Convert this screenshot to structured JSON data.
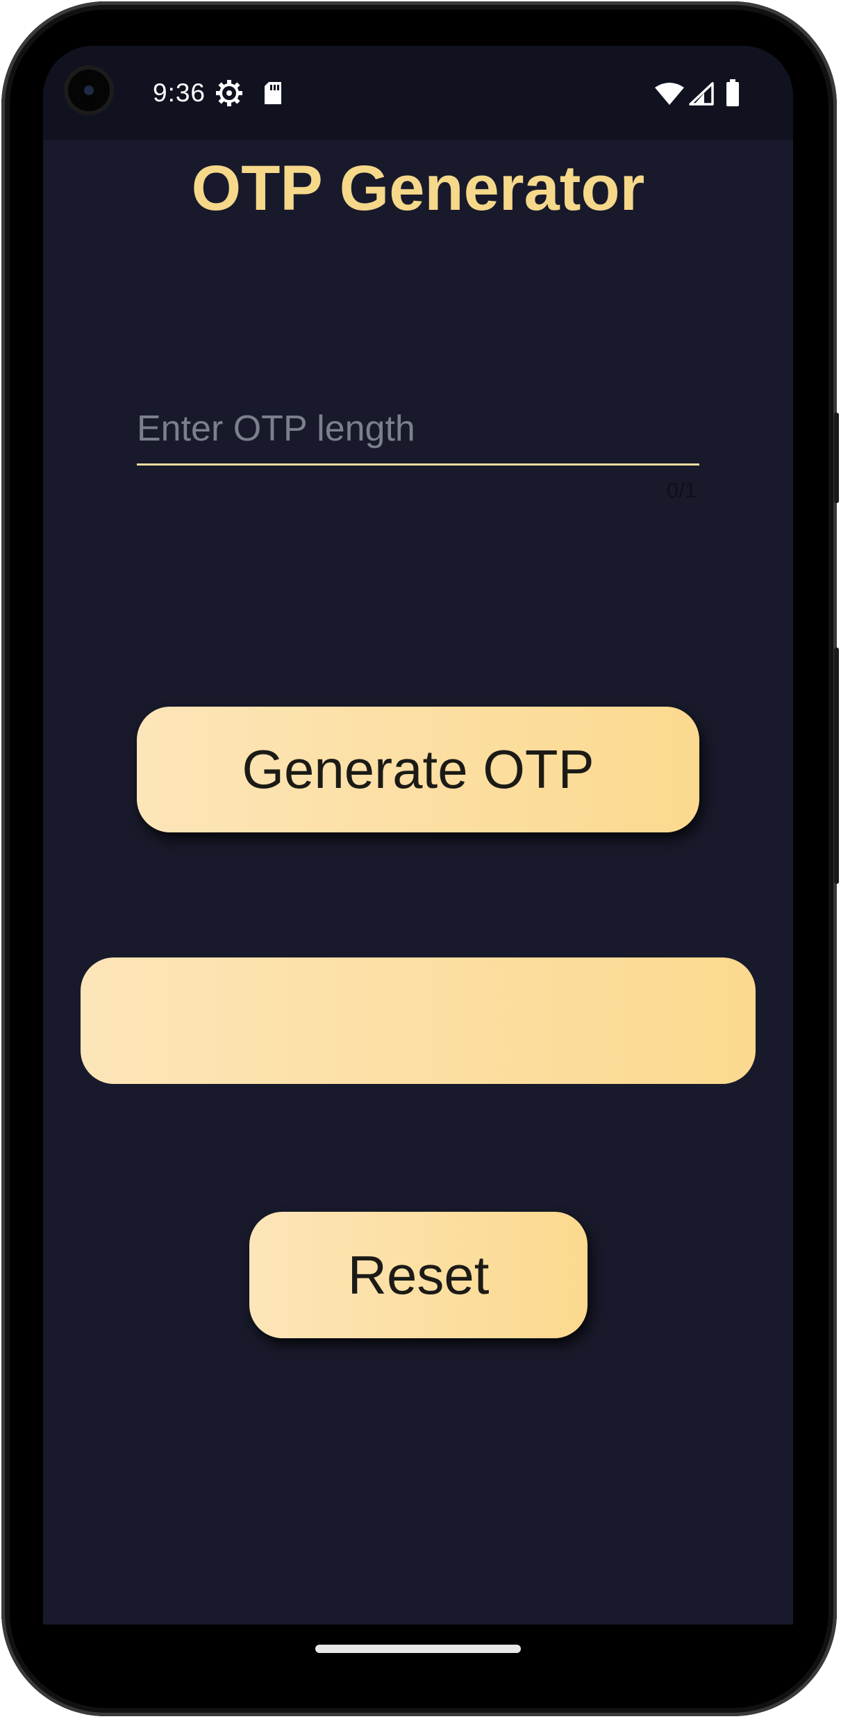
{
  "status_bar": {
    "time": "9:36",
    "left_icons": [
      "settings-gear-icon",
      "sd-card-icon"
    ],
    "right_icons": [
      "wifi-icon",
      "cellular-signal-icon",
      "battery-icon"
    ]
  },
  "app": {
    "title": "OTP Generator",
    "otp_length_input": {
      "value": "",
      "placeholder": "Enter OTP length",
      "counter": "0/1"
    },
    "generate_button_label": "Generate OTP",
    "otp_display_value": "",
    "reset_button_label": "Reset"
  },
  "colors": {
    "background": "#181a2b",
    "status_bar": "#101220",
    "title": "#f6d88a",
    "button_gradient_start": "#fce5b8",
    "button_gradient_end": "#fbd98f",
    "button_text": "#1b1a16",
    "underline": "#f3dea0"
  }
}
